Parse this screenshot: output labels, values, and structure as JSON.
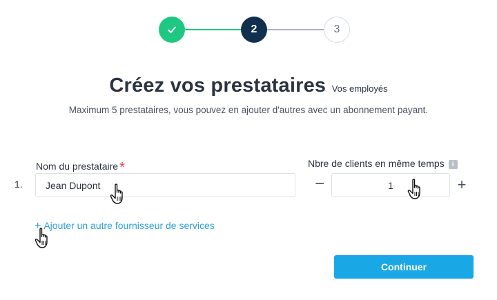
{
  "stepper": {
    "steps": [
      {
        "label": "",
        "state": "completed",
        "icon": "check-icon"
      },
      {
        "label": "2",
        "state": "active"
      },
      {
        "label": "3",
        "state": "upcoming"
      }
    ],
    "colors": {
      "completed": "#1ec882",
      "active": "#11304f",
      "upcoming": "#d5d9de"
    }
  },
  "header": {
    "title": "Créez vos prestataires",
    "subtitle": "Vos employés",
    "info": "Maximum 5 prestataires, vous pouvez en ajouter d'autres avec un abonnement payant."
  },
  "form": {
    "name_label": "Nom du prestataire",
    "required_marker": "*",
    "count_label": "Nbre de clients en même temps",
    "info_icon": "i",
    "rows": [
      {
        "index": "1.",
        "name": "Jean Dupont",
        "count": "1"
      }
    ],
    "minus_label": "−",
    "plus_label": "+",
    "add_plus": "+",
    "add_link": "Ajouter un autre fournisseur de services"
  },
  "actions": {
    "continue_label": "Continuer",
    "accent_color": "#1aa7e6"
  }
}
